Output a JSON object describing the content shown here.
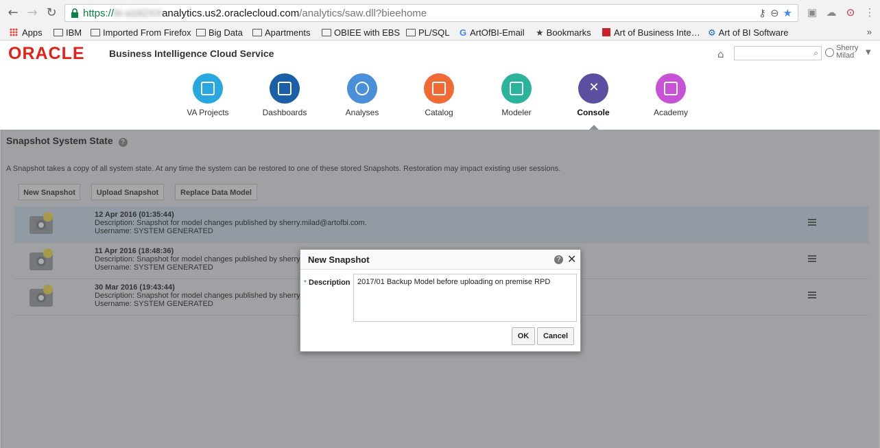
{
  "browser": {
    "url_scheme": "https://",
    "url_host_blurred": "bi-a162XX",
    "url_host": "analytics.us2.oraclecloud.com",
    "url_path": "/analytics/saw.dll?bieehome",
    "bookmarks": [
      {
        "label": "Apps",
        "icon": "apps-grid-icon"
      },
      {
        "label": "IBM",
        "icon": "folder-icon"
      },
      {
        "label": "Imported From Firefox",
        "icon": "folder-icon"
      },
      {
        "label": "Big Data",
        "icon": "folder-icon"
      },
      {
        "label": "Apartments",
        "icon": "folder-icon"
      },
      {
        "label": "OBIEE with EBS",
        "icon": "folder-icon"
      },
      {
        "label": "PL/SQL",
        "icon": "folder-icon"
      },
      {
        "label": "ArtOfBI-Email",
        "icon": "google-icon"
      },
      {
        "label": "Bookmarks",
        "icon": "star-icon"
      },
      {
        "label": "Art of Business Inte…",
        "icon": "red-square-icon"
      },
      {
        "label": "Art of BI Software",
        "icon": "gear-icon"
      }
    ],
    "more": "»"
  },
  "header": {
    "logo": "ORACLE",
    "product": "Business Intelligence Cloud Service",
    "user_first": "Sherry",
    "user_last": "Milad"
  },
  "apps": [
    {
      "label": "VA Projects",
      "color": "#29a8e0"
    },
    {
      "label": "Dashboards",
      "color": "#1a5fa8"
    },
    {
      "label": "Analyses",
      "color": "#4a90d9"
    },
    {
      "label": "Catalog",
      "color": "#f06a35"
    },
    {
      "label": "Modeler",
      "color": "#2bb39b"
    },
    {
      "label": "Console",
      "color": "#5b4fa1",
      "active": true
    },
    {
      "label": "Academy",
      "color": "#c752d6"
    }
  ],
  "page": {
    "title": "Snapshot System State",
    "description": "A Snapshot takes a copy of all system state. At any time the system can be restored to one of these stored Snapshots. Restoration may impact existing user sessions.",
    "buttons": {
      "new": "New Snapshot",
      "upload": "Upload Snapshot",
      "replace": "Replace Data Model"
    },
    "snapshots": [
      {
        "date": "12 Apr 2016 (01:35:44)",
        "description": "Description: Snapshot for model changes published by sherry.milad@artofbi.com.",
        "username": "Username: SYSTEM GENERATED"
      },
      {
        "date": "11 Apr 2016 (18:48:36)",
        "description": "Description: Snapshot for model changes published by sherry.",
        "username": "Username: SYSTEM GENERATED"
      },
      {
        "date": "30 Mar 2016 (19:43:44)",
        "description": "Description: Snapshot for model changes published by sherry.",
        "username": "Username: SYSTEM GENERATED"
      }
    ]
  },
  "dialog": {
    "title": "New Snapshot",
    "required_mark": "*",
    "label": "Description",
    "value": "2017/01 Backup Model before uploading on premise RPD",
    "ok": "OK",
    "cancel": "Cancel"
  }
}
